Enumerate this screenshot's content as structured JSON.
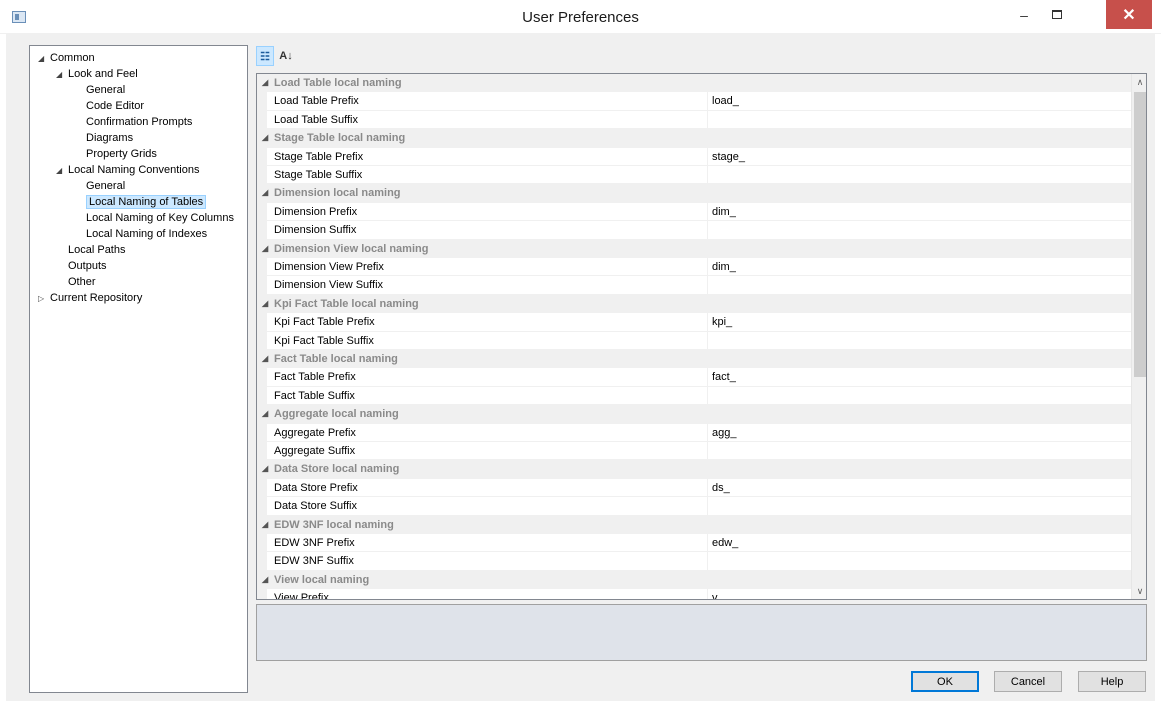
{
  "window": {
    "title": "User Preferences",
    "minimize": "–",
    "close": "✕"
  },
  "tree": {
    "items": [
      {
        "label": "Common",
        "expander": "◢"
      },
      {
        "label": "Look and Feel",
        "expander": "◢"
      },
      {
        "label": "General"
      },
      {
        "label": "Code Editor"
      },
      {
        "label": "Confirmation Prompts"
      },
      {
        "label": "Diagrams"
      },
      {
        "label": "Property Grids"
      },
      {
        "label": "Local Naming Conventions",
        "expander": "◢"
      },
      {
        "label": "General"
      },
      {
        "label": "Local Naming of Tables",
        "selected": true
      },
      {
        "label": "Local Naming of Key Columns"
      },
      {
        "label": "Local Naming of Indexes"
      },
      {
        "label": "Local Paths"
      },
      {
        "label": "Outputs"
      },
      {
        "label": "Other"
      },
      {
        "label": "Current Repository",
        "expander": "▷"
      }
    ]
  },
  "toolbar": {
    "categorized_icon": "categorized-icon",
    "alphabetical_icon": "sort-alphabetical-icon",
    "categorized_glyph": "☷",
    "alphabetical_glyph": "A↓"
  },
  "grid": {
    "rows": [
      {
        "kind": "cat",
        "label": "Load Table local naming"
      },
      {
        "kind": "prop",
        "label": "Load Table Prefix",
        "value": "load_"
      },
      {
        "kind": "prop",
        "label": "Load Table Suffix",
        "value": ""
      },
      {
        "kind": "cat",
        "label": "Stage Table local naming"
      },
      {
        "kind": "prop",
        "label": "Stage Table Prefix",
        "value": "stage_"
      },
      {
        "kind": "prop",
        "label": "Stage Table Suffix",
        "value": ""
      },
      {
        "kind": "cat",
        "label": "Dimension local naming"
      },
      {
        "kind": "prop",
        "label": "Dimension Prefix",
        "value": "dim_"
      },
      {
        "kind": "prop",
        "label": "Dimension Suffix",
        "value": ""
      },
      {
        "kind": "cat",
        "label": "Dimension View local naming"
      },
      {
        "kind": "prop",
        "label": "Dimension View Prefix",
        "value": "dim_"
      },
      {
        "kind": "prop",
        "label": "Dimension View Suffix",
        "value": ""
      },
      {
        "kind": "cat",
        "label": "Kpi Fact Table local naming"
      },
      {
        "kind": "prop",
        "label": "Kpi Fact Table Prefix",
        "value": "kpi_"
      },
      {
        "kind": "prop",
        "label": "Kpi Fact Table Suffix",
        "value": ""
      },
      {
        "kind": "cat",
        "label": "Fact Table local naming"
      },
      {
        "kind": "prop",
        "label": "Fact Table Prefix",
        "value": "fact_"
      },
      {
        "kind": "prop",
        "label": "Fact Table Suffix",
        "value": ""
      },
      {
        "kind": "cat",
        "label": "Aggregate local naming"
      },
      {
        "kind": "prop",
        "label": "Aggregate Prefix",
        "value": "agg_"
      },
      {
        "kind": "prop",
        "label": "Aggregate Suffix",
        "value": ""
      },
      {
        "kind": "cat",
        "label": "Data Store local naming"
      },
      {
        "kind": "prop",
        "label": "Data Store Prefix",
        "value": "ds_"
      },
      {
        "kind": "prop",
        "label": "Data Store Suffix",
        "value": ""
      },
      {
        "kind": "cat",
        "label": "EDW 3NF local naming"
      },
      {
        "kind": "prop",
        "label": "EDW 3NF Prefix",
        "value": "edw_"
      },
      {
        "kind": "prop",
        "label": "EDW 3NF Suffix",
        "value": ""
      },
      {
        "kind": "cat",
        "label": "View local naming"
      },
      {
        "kind": "prop",
        "label": "View Prefix",
        "value": "v_"
      }
    ],
    "cat_expander": "◢",
    "scroll_up": "∧",
    "scroll_down": "∨"
  },
  "buttons": {
    "ok": "OK",
    "cancel": "Cancel",
    "help": "Help"
  }
}
